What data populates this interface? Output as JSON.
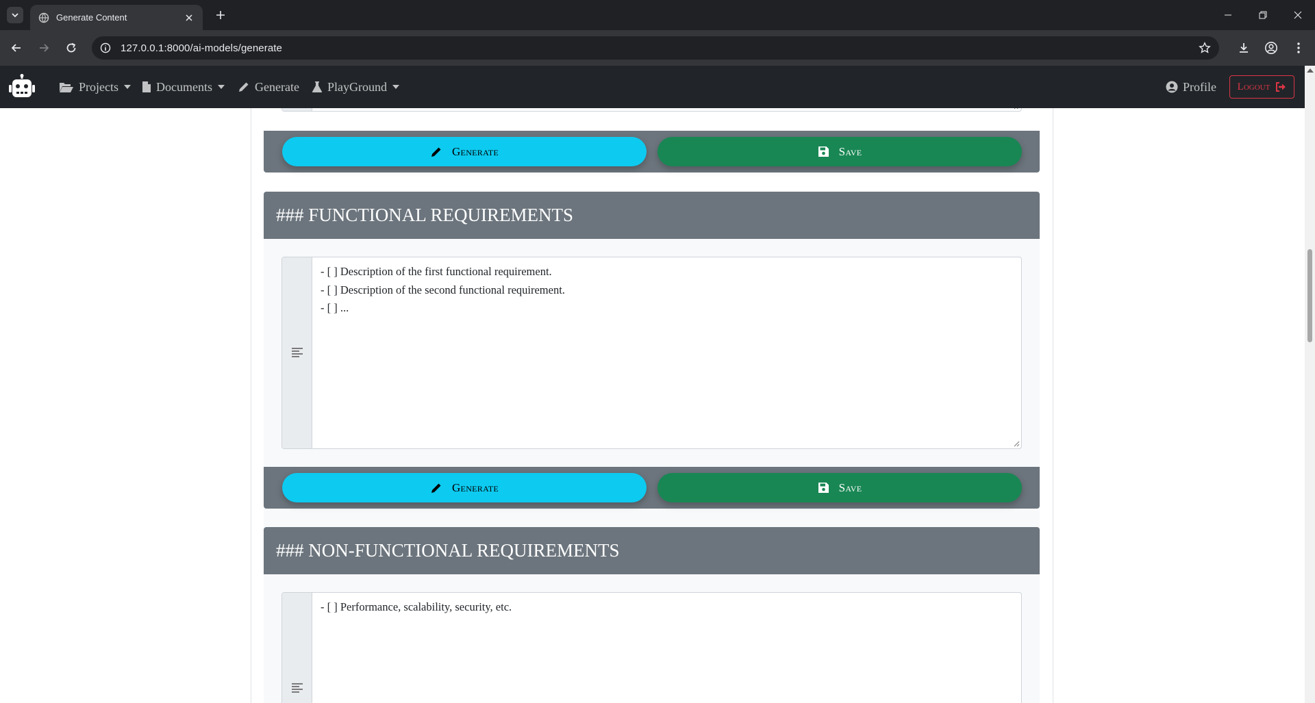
{
  "browser": {
    "tab_title": "Generate Content",
    "url": "127.0.0.1:8000/ai-models/generate"
  },
  "navbar": {
    "projects": "Projects",
    "documents": "Documents",
    "generate": "Generate",
    "playground": "PlayGround",
    "profile": "Profile",
    "logout": "Logout"
  },
  "buttons": {
    "generate": "Generate",
    "save": "Save"
  },
  "sections": [
    {
      "title": "### FUNCTIONAL REQUIREMENTS",
      "content": "- [ ] Description of the first functional requirement.\n- [ ] Description of the second functional requirement.\n- [ ] ..."
    },
    {
      "title": "### NON-FUNCTIONAL REQUIREMENTS",
      "content": "- [ ] Performance, scalability, security, etc."
    }
  ],
  "colors": {
    "generate_button": "#0dcaf0",
    "save_button": "#198754",
    "section_header": "#6c757d",
    "navbar": "#212529",
    "logout": "#dc3545"
  }
}
